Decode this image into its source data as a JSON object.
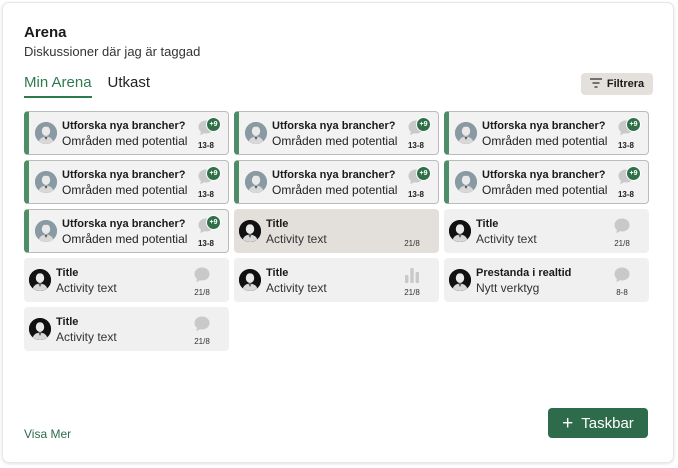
{
  "header": {
    "title": "Arena",
    "subtitle": "Diskussioner där jag är taggad"
  },
  "tabs": [
    {
      "label": "Min Arena",
      "active": true
    },
    {
      "label": "Utkast",
      "active": false
    }
  ],
  "filter": {
    "label": "Filtrera",
    "icon": "filter-icon"
  },
  "cards": [
    {
      "title": "Utforska nya brancher?",
      "activity": "Områden med potential",
      "date": "13-8",
      "badge": "+9",
      "tagged": true,
      "icon": "comment-icon"
    },
    {
      "title": "Utforska nya brancher?",
      "activity": "Områden med potential",
      "date": "13-8",
      "badge": "+9",
      "tagged": true,
      "icon": "comment-icon"
    },
    {
      "title": "Utforska nya brancher?",
      "activity": "Områden med potential",
      "date": "13-8",
      "badge": "+9",
      "tagged": true,
      "icon": "comment-icon"
    },
    {
      "title": "Utforska nya brancher?",
      "activity": "Områden med potential",
      "date": "13-8",
      "badge": "+9",
      "tagged": true,
      "icon": "comment-icon"
    },
    {
      "title": "Utforska nya brancher?",
      "activity": "Områden med potential",
      "date": "13-8",
      "badge": "+9",
      "tagged": true,
      "icon": "comment-icon"
    },
    {
      "title": "Utforska nya brancher?",
      "activity": "Områden med potential",
      "date": "13-8",
      "badge": "+9",
      "tagged": true,
      "icon": "comment-icon"
    },
    {
      "title": "Utforska nya brancher?",
      "activity": "Områden med potential",
      "date": "13-8",
      "badge": "+9",
      "tagged": true,
      "icon": "comment-icon"
    },
    {
      "title": "Title",
      "activity": "Activity text",
      "date": "21/8",
      "tagged": false,
      "selected": true,
      "icon": "none"
    },
    {
      "title": "Title",
      "activity": "Activity text",
      "date": "21/8",
      "tagged": false,
      "icon": "comment-icon"
    },
    {
      "title": "Title",
      "activity": "Activity text",
      "date": "21/8",
      "tagged": false,
      "icon": "comment-icon"
    },
    {
      "title": "Title",
      "activity": "Activity text",
      "date": "21/8",
      "tagged": false,
      "icon": "bar-chart-icon"
    },
    {
      "title": "Prestanda i realtid",
      "activity": "Nytt verktyg",
      "date": "8-8",
      "tagged": false,
      "icon": "comment-icon"
    },
    {
      "title": "Title",
      "activity": "Activity text",
      "date": "21/8",
      "tagged": false,
      "icon": "comment-icon"
    }
  ],
  "footer": {
    "show_more": "Visa Mer",
    "taskbar_label": "Taskbar",
    "taskbar_icon": "plus-icon"
  },
  "colors": {
    "accent": "#2e6b4a",
    "badge": "#2f7048",
    "tag_bar": "#4d8d67",
    "card_bg": "#f0f0f0",
    "selected_bg": "#e3dfdb"
  }
}
